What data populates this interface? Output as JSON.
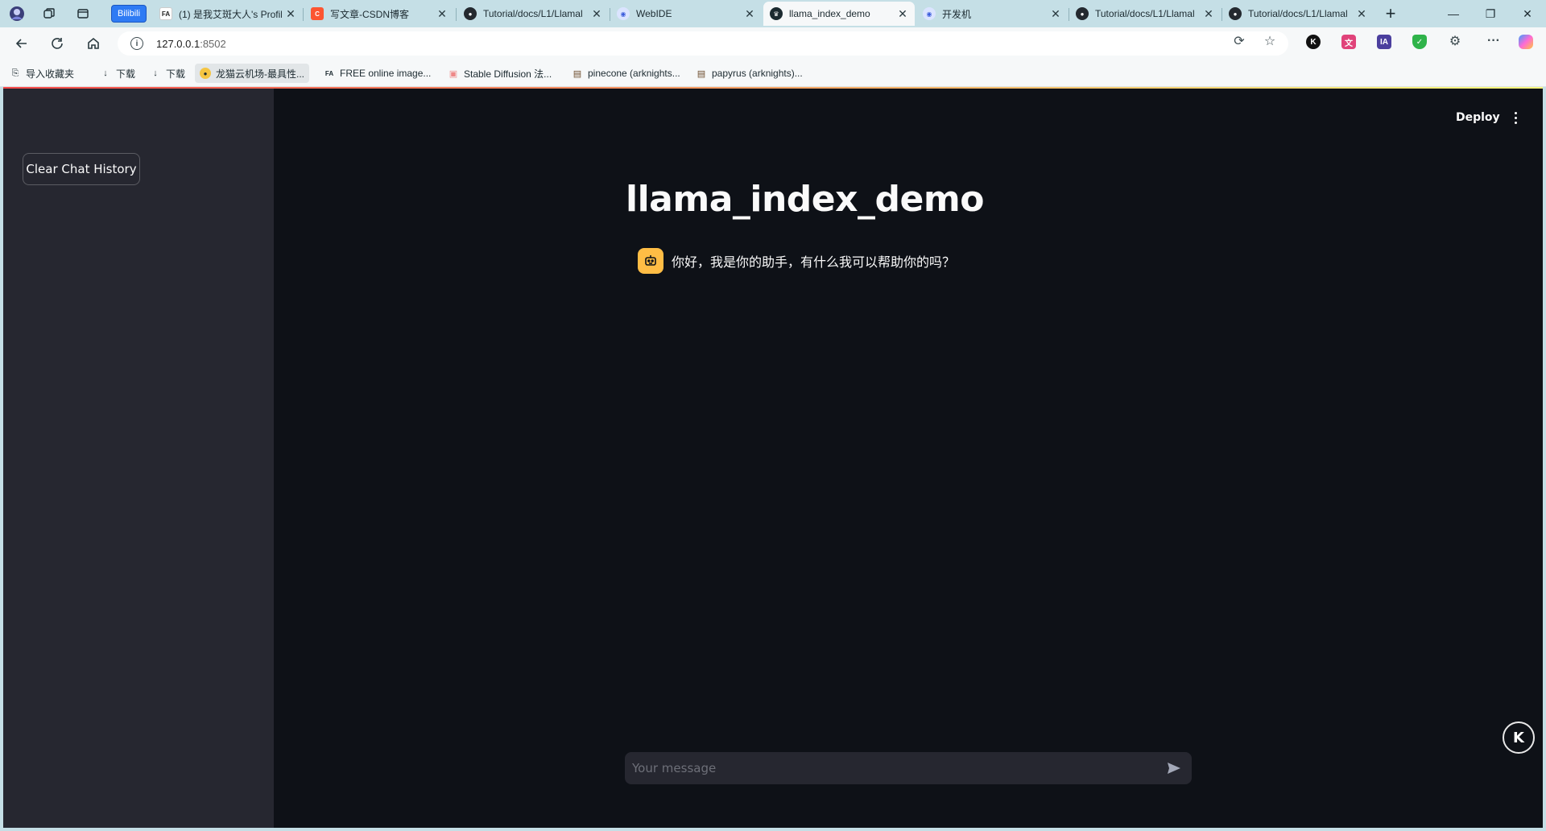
{
  "browser": {
    "tabs": [
      {
        "label": "Bilibili",
        "kind": "pill"
      },
      {
        "label": "(1) 是我艾斑大人's Profil",
        "favicon": "fa-icon",
        "color": "#ffffff"
      },
      {
        "label": "写文章-CSDN博客",
        "favicon": "csdn-icon",
        "color": "#fc5531"
      },
      {
        "label": "Tutorial/docs/L1/Llamal",
        "favicon": "github-icon",
        "color": "#24292f"
      },
      {
        "label": "WebIDE",
        "favicon": "webide-icon",
        "color": "#3b5bdb"
      },
      {
        "label": "llama_index_demo",
        "favicon": "streamlit-icon",
        "color": "#1c2a30",
        "active": true
      },
      {
        "label": "开发机",
        "favicon": "webide-icon",
        "color": "#3b5bdb"
      },
      {
        "label": "Tutorial/docs/L1/Llamal",
        "favicon": "github-icon",
        "color": "#24292f"
      },
      {
        "label": "Tutorial/docs/L1/Llamal",
        "favicon": "github-icon",
        "color": "#24292f"
      }
    ],
    "address": {
      "host": "127.0.0.1",
      "port": ":8502"
    },
    "bookmarks": [
      {
        "label": "导入收藏夹",
        "icon": "import-icon"
      },
      {
        "label": "下载",
        "icon": "download-icon"
      },
      {
        "label": "下载",
        "icon": "download-icon"
      },
      {
        "label": "龙猫云机场-最具性...",
        "icon": "totoro-icon",
        "highlight": true
      },
      {
        "label": "FREE online image...",
        "icon": "fa-icon"
      },
      {
        "label": "Stable Diffusion 法...",
        "icon": "sd-icon"
      },
      {
        "label": "pinecone (arknights...",
        "icon": "folder-icon"
      },
      {
        "label": "papyrus (arknights)...",
        "icon": "folder-icon"
      }
    ]
  },
  "app": {
    "sidebar": {
      "clear_button": "Clear Chat History"
    },
    "header": {
      "deploy_label": "Deploy"
    },
    "title": "llama_index_demo",
    "messages": [
      {
        "role": "assistant",
        "text": "你好，我是你的助手，有什么我可以帮助你的吗？"
      }
    ],
    "chat_input": {
      "placeholder": "Your message"
    },
    "colors": {
      "background": "#0e1117",
      "sidebar": "#262730",
      "avatar": "#ffbd45",
      "text": "#fafafa"
    }
  }
}
